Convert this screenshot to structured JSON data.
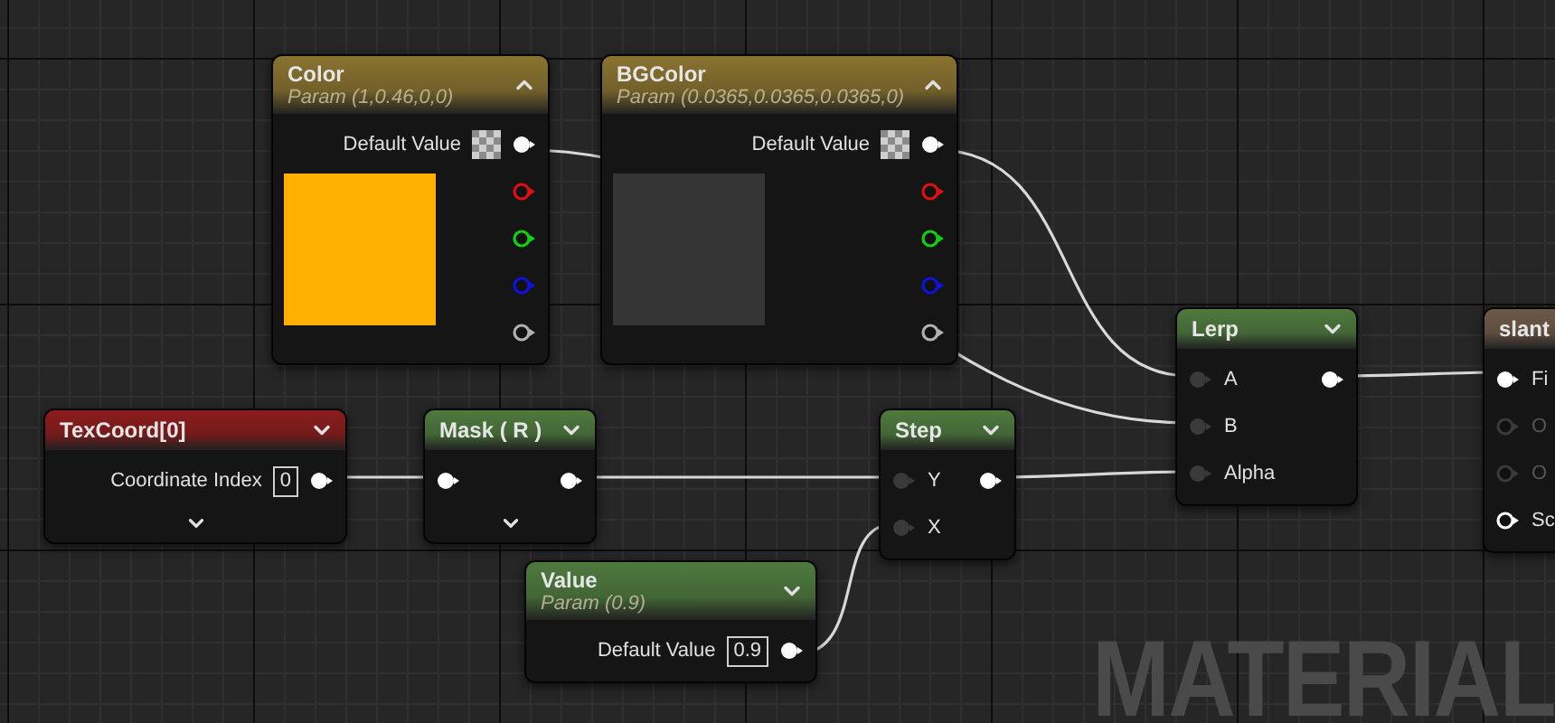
{
  "nodes": [
    {
      "title": "Color",
      "subtitle": "Param (1,0.46,0,0)",
      "color": "#8a7330",
      "expanded": true,
      "property": {
        "label": "Default Value",
        "kind": "checker"
      },
      "preview": {
        "color": "#ffb000"
      },
      "outputs": [
        {
          "kind": "filled",
          "color": "#ffffff"
        },
        {
          "kind": "ring",
          "color": "#e01010"
        },
        {
          "kind": "ring",
          "color": "#10d010"
        },
        {
          "kind": "ring",
          "color": "#1010e0"
        },
        {
          "kind": "ring",
          "color": "#b0b0b0"
        }
      ],
      "advanced": false
    },
    {
      "title": "BGColor",
      "subtitle": "Param (0.0365,0.0365,0.0365,0)",
      "color": "#8a7330",
      "expanded": true,
      "property": {
        "label": "Default Value",
        "kind": "checker"
      },
      "preview": {
        "color": "#353535"
      },
      "outputs": [
        {
          "kind": "filled",
          "color": "#ffffff"
        },
        {
          "kind": "ring",
          "color": "#e01010"
        },
        {
          "kind": "ring",
          "color": "#10d010"
        },
        {
          "kind": "ring",
          "color": "#1010e0"
        },
        {
          "kind": "ring",
          "color": "#b0b0b0"
        }
      ],
      "advanced": false
    },
    {
      "title": "TexCoord[0]",
      "color": "#8c1c1c",
      "expanded": false,
      "property": {
        "label": "Coordinate Index",
        "kind": "value",
        "value": "0"
      },
      "outputs": [
        {
          "kind": "filled",
          "color": "#ffffff"
        }
      ],
      "advanced": true
    },
    {
      "title": "Mask ( R )",
      "color": "#4e7a3e",
      "expanded": false,
      "inputs": [
        {
          "kind": "filled"
        }
      ],
      "outputs": [
        {
          "kind": "filled",
          "color": "#ffffff"
        }
      ],
      "advanced": true
    },
    {
      "title": "Step",
      "color": "#4e7a3e",
      "expanded": false,
      "inputs": [
        {
          "label": "Y",
          "kind": "socket"
        },
        {
          "label": "X",
          "kind": "socket"
        }
      ],
      "outputs": [
        {
          "kind": "filled",
          "color": "#ffffff"
        }
      ],
      "advanced": false
    },
    {
      "title": "Value",
      "subtitle": "Param (0.9)",
      "color": "#4e7a3e",
      "expanded": false,
      "property": {
        "label": "Default Value",
        "kind": "value",
        "value": "0.9"
      },
      "outputs": [
        {
          "kind": "filled",
          "color": "#ffffff"
        }
      ],
      "advanced": false
    },
    {
      "title": "Lerp",
      "color": "#4e7a3e",
      "expanded": false,
      "inputs": [
        {
          "label": "A",
          "kind": "socket"
        },
        {
          "label": "B",
          "kind": "socket"
        },
        {
          "label": "Alpha",
          "kind": "socket"
        }
      ],
      "outputs": [
        {
          "kind": "filled",
          "color": "#ffffff"
        }
      ],
      "advanced": false
    },
    {
      "title": "slant",
      "color": "#6f5a48",
      "inputs": [
        {
          "label": "Fi",
          "kind": "filled"
        },
        {
          "label": "O",
          "kind": "dim"
        },
        {
          "label": "O",
          "kind": "dim"
        },
        {
          "label": "Sc",
          "kind": "ring"
        }
      ],
      "advanced": false
    }
  ],
  "corner_label": "MATERIAL"
}
